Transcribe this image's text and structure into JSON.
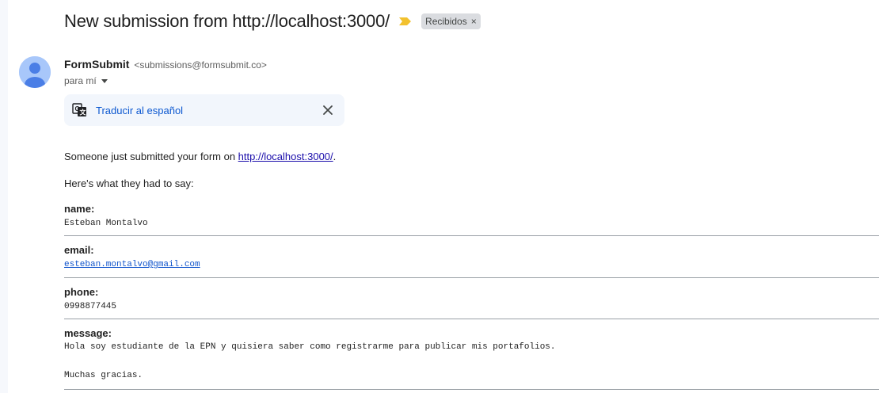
{
  "email": {
    "subject": "New submission from http://localhost:3000/",
    "label": "Recibidos",
    "label_remove": "×",
    "sender_name": "FormSubmit",
    "sender_email": "<submissions@formsubmit.co>",
    "recipient": "para mí",
    "translate_text": "Traducir al español",
    "intro_prefix": "Someone just submitted your form on ",
    "intro_link": "http://localhost:3000/",
    "intro_suffix": ".",
    "lead": "Here's what they had to say:",
    "fields": [
      {
        "label": "name:",
        "value": "Esteban Montalvo"
      },
      {
        "label": "email:",
        "value": "esteban.montalvo@gmail.com"
      },
      {
        "label": "phone:",
        "value": "0998877445"
      },
      {
        "label": "message:",
        "value": "Hola soy estudiante de la EPN y quisiera saber como registrarme para publicar mis portafolios.\n\nMuchas gracias."
      }
    ]
  },
  "colors": {
    "importance_marker": "#f2c12e",
    "link": "#1a0dab",
    "translate_link": "#0b57d0",
    "avatar_bg": "#a8c7fa",
    "avatar_fg": "#4a7ee6"
  },
  "icons": {
    "importance": "importance-marker-icon",
    "avatar": "person-avatar-icon",
    "dropdown": "caret-down-icon",
    "translate": "translate-icon",
    "close": "close-icon"
  }
}
